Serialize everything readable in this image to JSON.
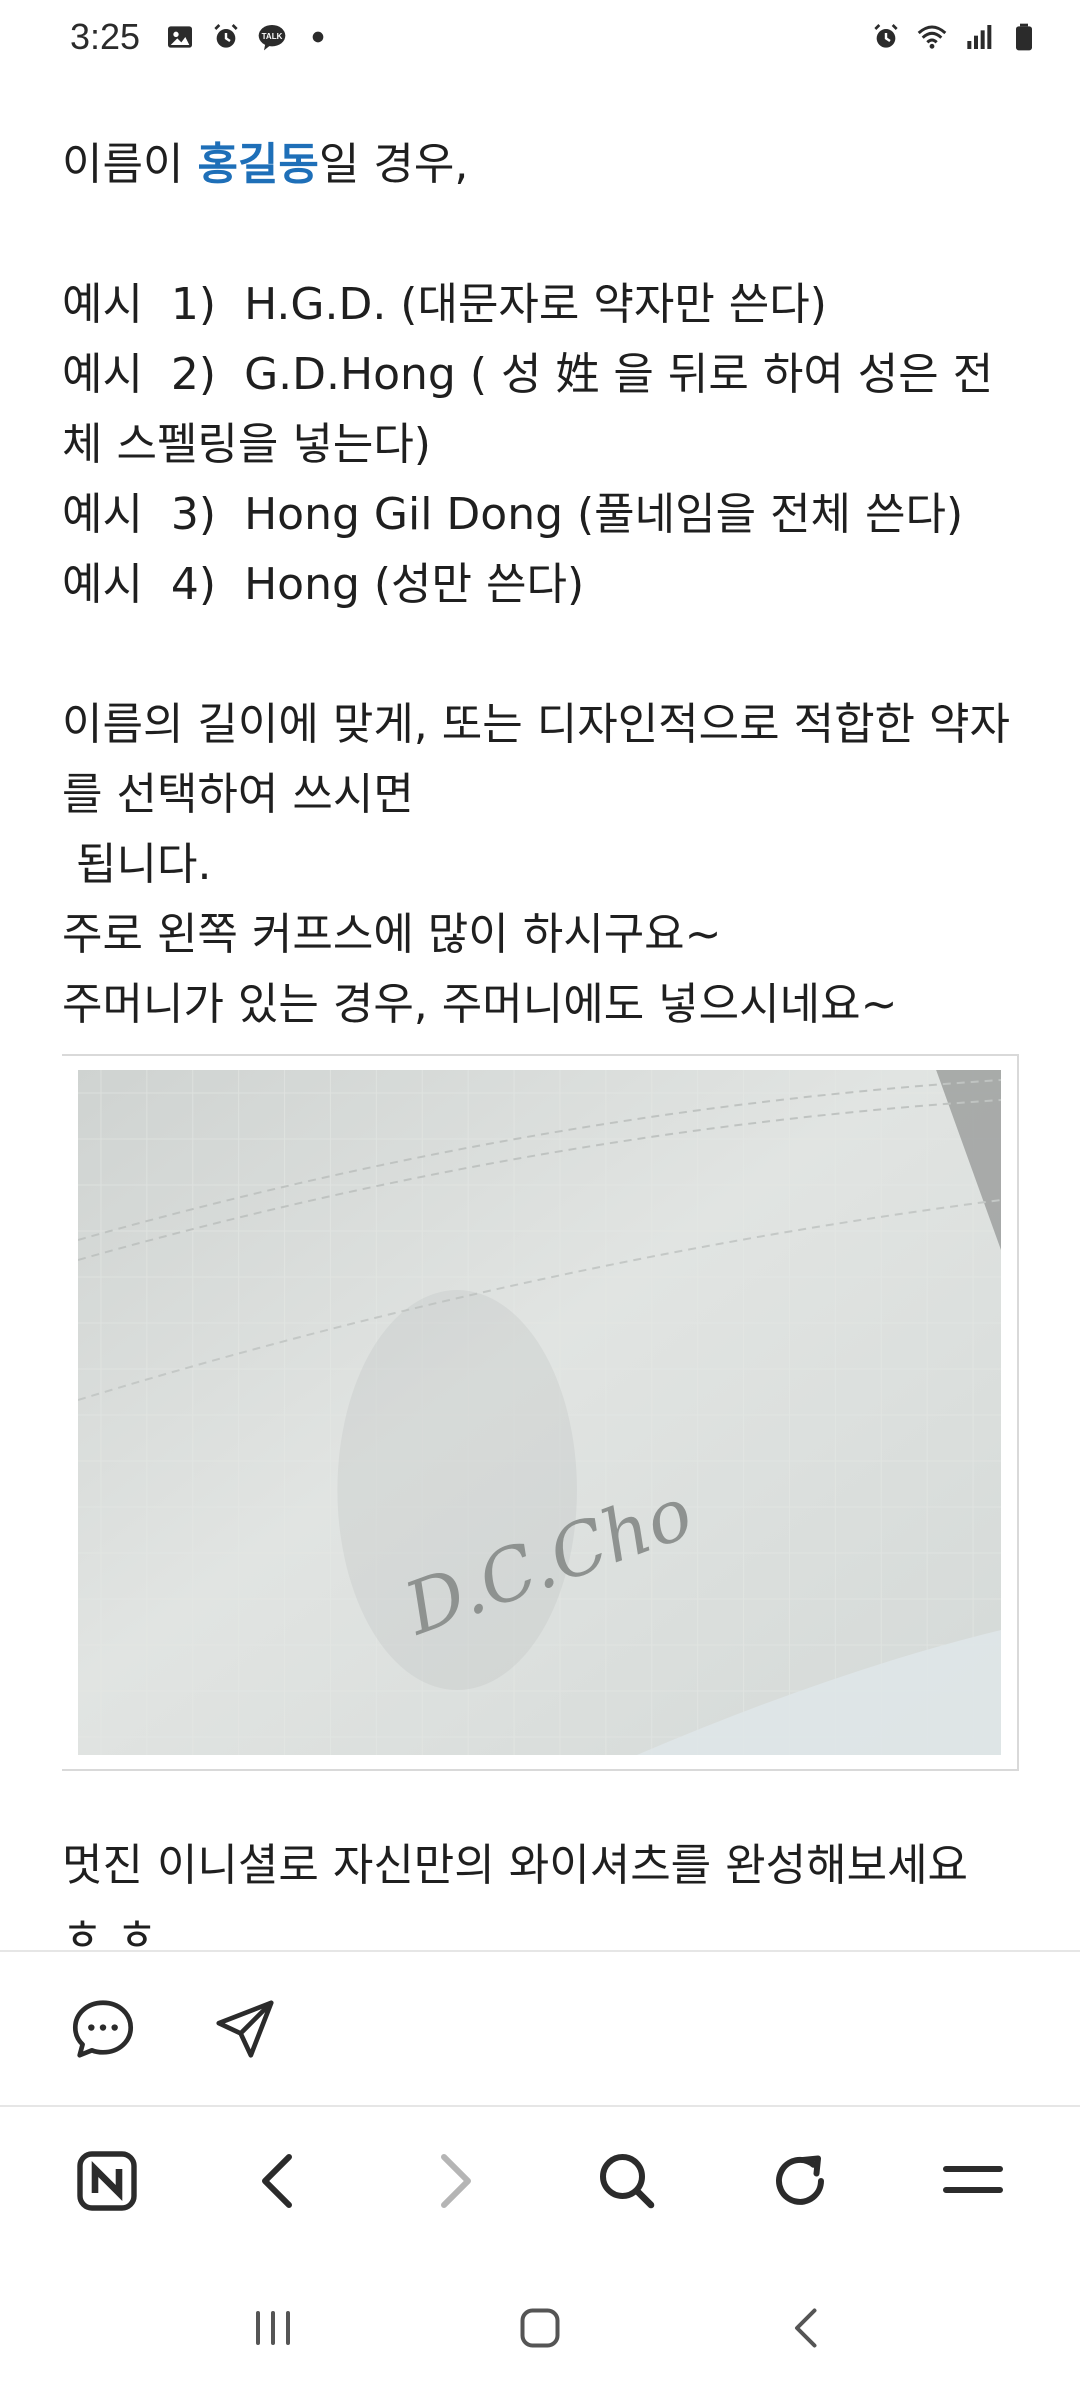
{
  "status_bar": {
    "time": "3:25",
    "left_icons": [
      "image-icon",
      "alarm-icon",
      "kakaotalk-icon",
      "dot-icon"
    ],
    "right_icons": [
      "alarm-icon",
      "wifi-icon",
      "signal-icon",
      "battery-icon"
    ]
  },
  "article": {
    "intro_prefix": "이름이 ",
    "intro_name": "홍길동",
    "intro_suffix": "일 경우,",
    "examples": [
      "예시  1)  H.G.D. (대문자로 약자만 쓴다)",
      "예시  2)  G.D.Hong ( 성 姓 을 뒤로 하여 성은 전체 스펠링을 넣는다)",
      "예시  3)  Hong Gil Dong (풀네임을 전체 쓴다)",
      "예시  4)  Hong (성만 쓴다)"
    ],
    "advice_1": "이름의 길이에 맞게, 또는 디자인적으로 적합한 약자를 선택하여 쓰시면",
    "advice_2": " 됩니다.",
    "advice_3": "주로 왼쪽 커프스에 많이 하시구요~",
    "advice_4": "주머니가 있는 경우, 주머니에도 넣으시네요~",
    "photo_monogram": "D.C.Cho",
    "closing_1": "멋진 이니셜로 자신만의 와이셔츠를 완성해보세요",
    "closing_2": "ㅎ ㅎ"
  },
  "action_bar": {
    "icons": [
      "comment-icon",
      "share-icon"
    ]
  },
  "nav_bar": {
    "icons": [
      "naver-home-icon",
      "back-icon",
      "forward-icon",
      "search-icon",
      "refresh-icon",
      "menu-icon"
    ]
  },
  "system_bar": {
    "icons": [
      "recent-apps-icon",
      "home-icon",
      "system-back-icon"
    ]
  },
  "colors": {
    "highlight": "#1e6fb8",
    "text": "#1f1f1f",
    "divider": "#e6e6e6",
    "icon": "#2b2b2b",
    "icon_disabled": "#b5b5b5"
  }
}
